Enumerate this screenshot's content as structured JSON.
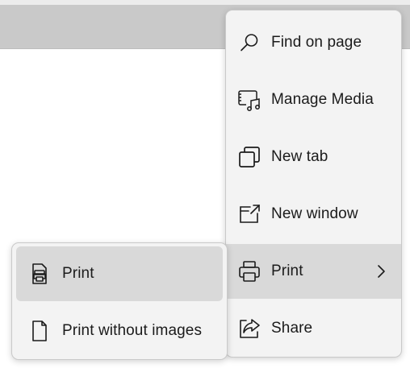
{
  "browser": {
    "toolbar_color": "#c9c9c9"
  },
  "main_menu": {
    "items": [
      {
        "label": "Find on page",
        "icon": "search-icon"
      },
      {
        "label": "Manage Media",
        "icon": "manage-media-icon"
      },
      {
        "label": "New tab",
        "icon": "new-tab-icon"
      },
      {
        "label": "New window",
        "icon": "new-window-icon"
      },
      {
        "label": "Print",
        "icon": "printer-icon",
        "has_submenu": true,
        "highlighted": true
      },
      {
        "label": "Share",
        "icon": "share-icon"
      }
    ]
  },
  "print_submenu": {
    "items": [
      {
        "label": "Print",
        "icon": "print-document-icon",
        "highlighted": true
      },
      {
        "label": "Print without images",
        "icon": "blank-page-icon"
      }
    ]
  },
  "colors": {
    "menu_background": "#f3f3f3",
    "highlight": "#d9d9d9",
    "text": "#1b1b1b"
  }
}
